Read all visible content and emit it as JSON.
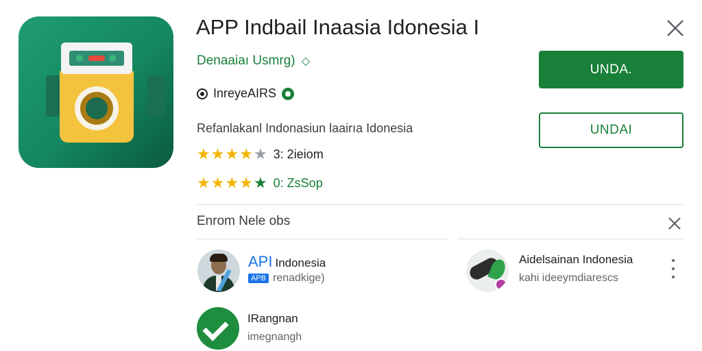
{
  "header": {
    "title": "APP Indbail Inaasia Idonesia I",
    "developer": "Denaaiaı Usmrg)",
    "developer_badge": "◇",
    "contains": "InreyeAIRS",
    "description": "Refanlakanl Indonasiun laairıa Idonesia"
  },
  "ratings": [
    {
      "stars": 4,
      "text": "3: 2ieiom"
    },
    {
      "stars": 4.5,
      "text": "0: ZsSop"
    }
  ],
  "buttons": {
    "primary_label": "UNDA.",
    "secondary_label": "UNDAI"
  },
  "section": {
    "title": "Enrom Nele obs",
    "items": [
      {
        "prefix": "API",
        "title": "Indonesia",
        "tag": "APB",
        "subtitle": "renadkige)"
      },
      {
        "title": "Aidelsainan Indonesia",
        "subtitle": "kahi ideeymdiarescs"
      },
      {
        "title": "IRangnan",
        "subtitle": "imegnangh"
      }
    ]
  },
  "colors": {
    "accent": "#188038",
    "star": "#f4b400",
    "link_blue": "#1a73e8"
  }
}
